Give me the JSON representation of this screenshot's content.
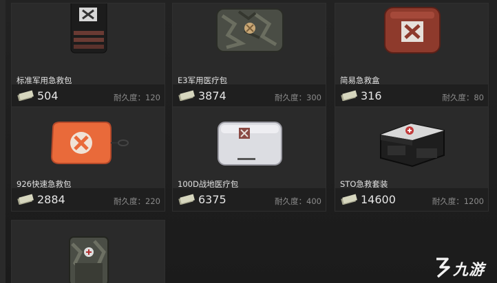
{
  "items": [
    {
      "name": "标准军用急救包",
      "price": "504",
      "durability_label": "耐久度：",
      "durability": "120"
    },
    {
      "name": "E3军用医疗包",
      "price": "3874",
      "durability_label": "耐久度：",
      "durability": "300"
    },
    {
      "name": "简易急救盒",
      "price": "316",
      "durability_label": "耐久度：",
      "durability": "80"
    },
    {
      "name": "926快速急救包",
      "price": "2884",
      "durability_label": "耐久度：",
      "durability": "220"
    },
    {
      "name": "100D战地医疗包",
      "price": "6375",
      "durability_label": "耐久度：",
      "durability": "400"
    },
    {
      "name": "STO急救套装",
      "price": "14600",
      "durability_label": "耐久度：",
      "durability": "1200"
    },
    {
      "name": "",
      "price": "",
      "durability_label": "",
      "durability": ""
    }
  ],
  "watermark": {
    "text": "九游"
  },
  "colors": {
    "background": "#1a1a1a",
    "card": "#2a2a2a",
    "card_bar": "#1f1f1f",
    "text": "#e2e2e2",
    "muted": "#8b8b8b"
  }
}
